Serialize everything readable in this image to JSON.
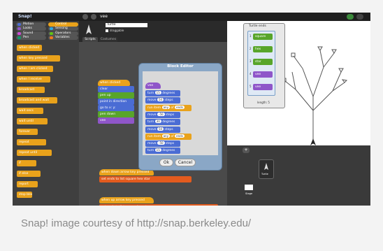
{
  "topbar": {
    "project_title": "vee",
    "logo": "Snap!"
  },
  "categories": [
    {
      "label": "Motion",
      "color": "#4a6cd4"
    },
    {
      "label": "Control",
      "color": "#e9a21b"
    },
    {
      "label": "Looks",
      "color": "#8f56c9"
    },
    {
      "label": "Sensing",
      "color": "#2ca5e2"
    },
    {
      "label": "Sound",
      "color": "#cf4ad9"
    },
    {
      "label": "Operators",
      "color": "#62c213"
    },
    {
      "label": "Pen",
      "color": "#0e9a6c"
    },
    {
      "label": "Variables",
      "color": "#f3761d"
    }
  ],
  "palette": {
    "blocks": [
      "when clicked",
      "when key pressed",
      "when I am clicked",
      "when I receive",
      "broadcast",
      "broadcast and wait",
      "wait secs",
      "wait until",
      "forever",
      "repeat",
      "repeat until",
      "if",
      "if else",
      "report",
      "stop block"
    ]
  },
  "sprite": {
    "name": "Turtle",
    "draggable_label": "draggable"
  },
  "tabs": {
    "scripts": "Scripts",
    "costumes": "Costumes"
  },
  "script_blocks": [
    "when clicked",
    "clear",
    "pen up",
    "point in direction",
    "go to x: y:",
    "pen down",
    "vee"
  ],
  "block_editor": {
    "title": "Block Editor",
    "hat_label": "vee",
    "body": [
      {
        "text": "turn",
        "value": "15",
        "suffix": "degrees"
      },
      {
        "text": "move",
        "value": "50",
        "suffix": "steps"
      },
      {
        "text": "run item",
        "value": "any",
        "suffix": "of",
        "list": "ends"
      },
      {
        "text": "move",
        "value": "-50",
        "suffix": "steps"
      },
      {
        "text": "turn",
        "value": "30",
        "suffix": "degrees"
      },
      {
        "text": "move",
        "value": "50",
        "suffix": "steps"
      },
      {
        "text": "run item",
        "value": "any",
        "suffix": "of",
        "list": "ends"
      },
      {
        "text": "move",
        "value": "-50",
        "suffix": "steps"
      },
      {
        "text": "turn",
        "value": "15",
        "suffix": "degrees"
      }
    ],
    "ok_label": "Ok",
    "cancel_label": "Cancel"
  },
  "bottom_scripts": [
    {
      "hat": "when down arrow key pressed",
      "set": "set ends to list square hex star"
    },
    {
      "hat": "when up arrow key pressed",
      "set": "set ends to list square hex star vee vee"
    }
  ],
  "turtle_ends": {
    "title": "Turtle ends",
    "items": [
      "square",
      "hex",
      "star",
      "vee",
      "vee"
    ],
    "length_label": "length: 5"
  },
  "corral": {
    "sprite_label": "Turtle",
    "stage_label": "Stage"
  },
  "caption": "Snap! image courtesy of http://snap.berkeley.edu/"
}
